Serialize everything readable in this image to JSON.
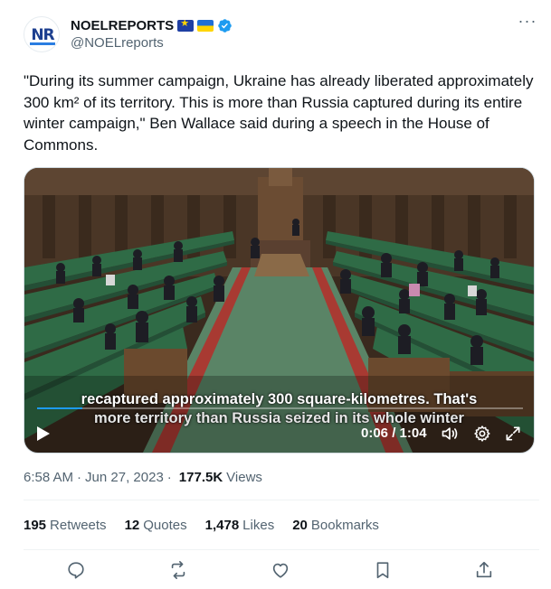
{
  "author": {
    "display_name": "NOELREPORTS",
    "handle": "@NOELreports",
    "avatar_logo": "NR",
    "badges": [
      "eu-flag-icon",
      "ukraine-flag-icon",
      "verified-badge-icon"
    ]
  },
  "tweet": {
    "text": "\"During its summer campaign, Ukraine has already liberated approximately 300 km² of its territory. This is more than Russia captured during its entire winter campaign,\" Ben Wallace said during a speech in the House of Commons."
  },
  "video": {
    "caption_line1": "recaptured approximately 300 square-kilometres. That's",
    "caption_line2": "more territory than Russia seized in its whole winter",
    "time_display": "0:06 / 1:04",
    "progress_fraction": 0.094,
    "icons": [
      "play-icon",
      "volume-icon",
      "settings-gear-icon",
      "fullscreen-icon"
    ]
  },
  "meta": {
    "time": "6:58 AM",
    "date": "Jun 27, 2023",
    "views_count": "177.5K",
    "views_label": "Views",
    "sep": "·"
  },
  "stats": {
    "retweets_count": "195",
    "retweets_label": "Retweets",
    "quotes_count": "12",
    "quotes_label": "Quotes",
    "likes_count": "1,478",
    "likes_label": "Likes",
    "bookmarks_count": "20",
    "bookmarks_label": "Bookmarks"
  },
  "actions": [
    "reply-icon",
    "retweet-icon",
    "like-icon",
    "bookmark-icon",
    "share-icon"
  ],
  "colors": {
    "accent": "#1d9bf0",
    "text_primary": "#0f1419",
    "text_secondary": "#536471",
    "bench_green": "#2f6b46"
  }
}
